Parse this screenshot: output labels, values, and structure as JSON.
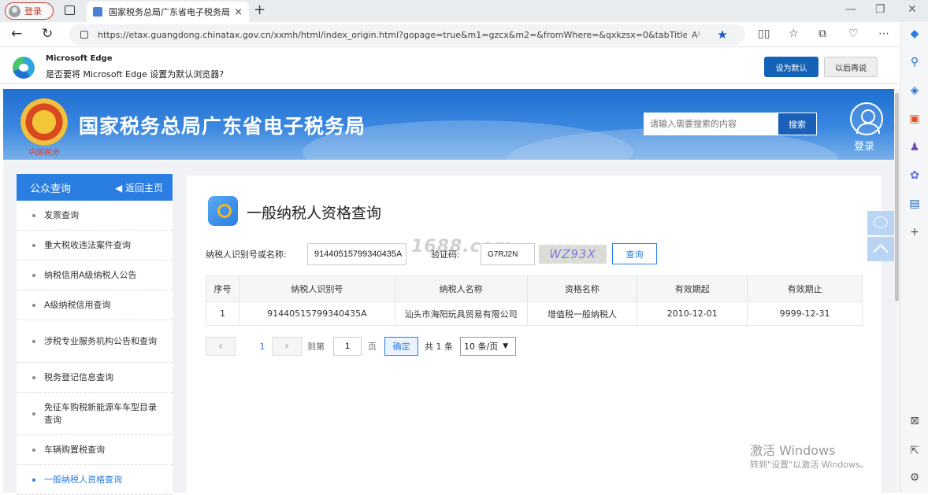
{
  "browser": {
    "profile_label": "登录",
    "tab_title": "国家税务总局广东省电子税务局",
    "tab_close": "×",
    "new_tab": "+",
    "url": "https://etax.guangdong.chinatax.gov.cn/xxmh/html/index_origin.html?gopage=true&m1=gzcx&m2=&fromWhere=&qxkzsx=0&tabTitle=...",
    "read_aloud": "A⁾",
    "star": "★"
  },
  "edge_prompt": {
    "heading": "Microsoft Edge",
    "message": "是否要将 Microsoft Edge 设置为默认浏览器?",
    "set_default": "设为默认",
    "later": "以后再说"
  },
  "banner": {
    "site_title": "国家税务总局广东省电子税务局",
    "seal_text": "中国税务",
    "search_placeholder": "请输入需要搜索的内容",
    "search_button": "搜索",
    "login_label": "登录"
  },
  "menu": {
    "title": "公众查询",
    "back": "◀ 返回主页",
    "items": [
      {
        "label": "发票查询"
      },
      {
        "label": "重大税收违法案件查询"
      },
      {
        "label": "纳税信用A级纳税人公告"
      },
      {
        "label": "A级纳税信用查询"
      },
      {
        "label": "涉税专业服务机构公告和查询"
      },
      {
        "label": "税务登记信息查询"
      },
      {
        "label": "免征车购税新能源车车型目录查询"
      },
      {
        "label": "车辆购置税查询"
      },
      {
        "label": "一般纳税人资格查询"
      }
    ]
  },
  "main": {
    "title": "一般纳税人资格查询",
    "id_label": "纳税人识别号或名称:",
    "id_value": "91440515799340435A",
    "captcha_label": "验证码:",
    "captcha_value": "G7RJ2N",
    "captcha_image_text": "WZ93X",
    "query_button": "查询",
    "watermark": "1688.com",
    "table": {
      "headers": [
        "序号",
        "纳税人识别号",
        "纳税人名称",
        "资格名称",
        "有效期起",
        "有效期止"
      ],
      "rows": [
        [
          "1",
          "91440515799340435A",
          "汕头市海阳玩具贸易有限公司",
          "增值税一般纳税人",
          "2010-12-01",
          "9999-12-31"
        ]
      ]
    },
    "pager": {
      "prev": "‹",
      "next": "›",
      "current": "1",
      "goto_label": "到第",
      "goto_value": "1",
      "page_unit": "页",
      "ok": "确定",
      "total": "共 1 条",
      "page_size": "10 条/页"
    }
  },
  "os": {
    "activate_title": "激活 Windows",
    "activate_desc": "转到\"设置\"以激活 Windows。"
  }
}
